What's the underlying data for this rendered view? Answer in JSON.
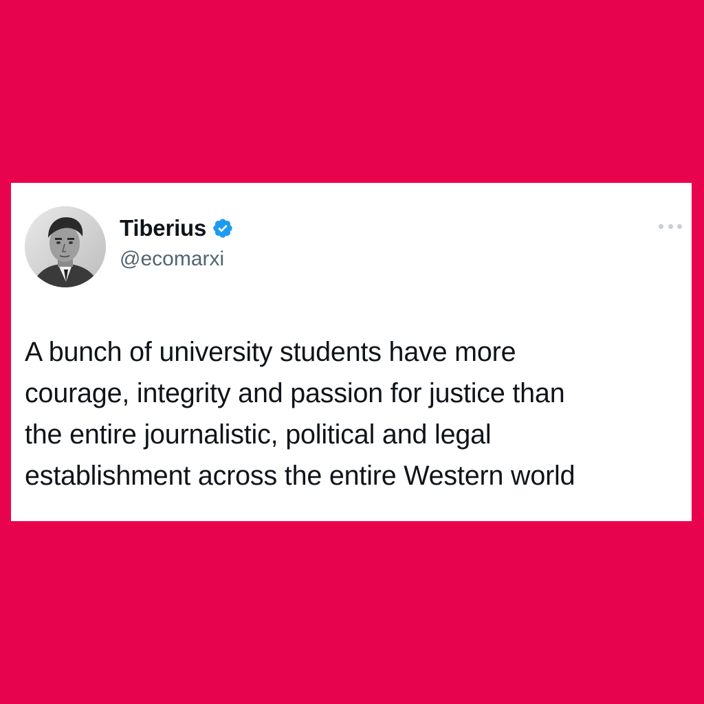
{
  "background_color": "#E8034F",
  "tweet": {
    "avatar_icon": "user-avatar",
    "display_name": "Tiberius",
    "verified_icon": "verified-badge-icon",
    "verified_color": "#1D9BF0",
    "handle": "@ecomarxi",
    "more_icon": "more-horizontal-icon",
    "text": "A bunch of university students have more\ncourage, integrity and passion for justice than\nthe entire journalistic, political and legal\nestablishment across the entire Western world"
  }
}
